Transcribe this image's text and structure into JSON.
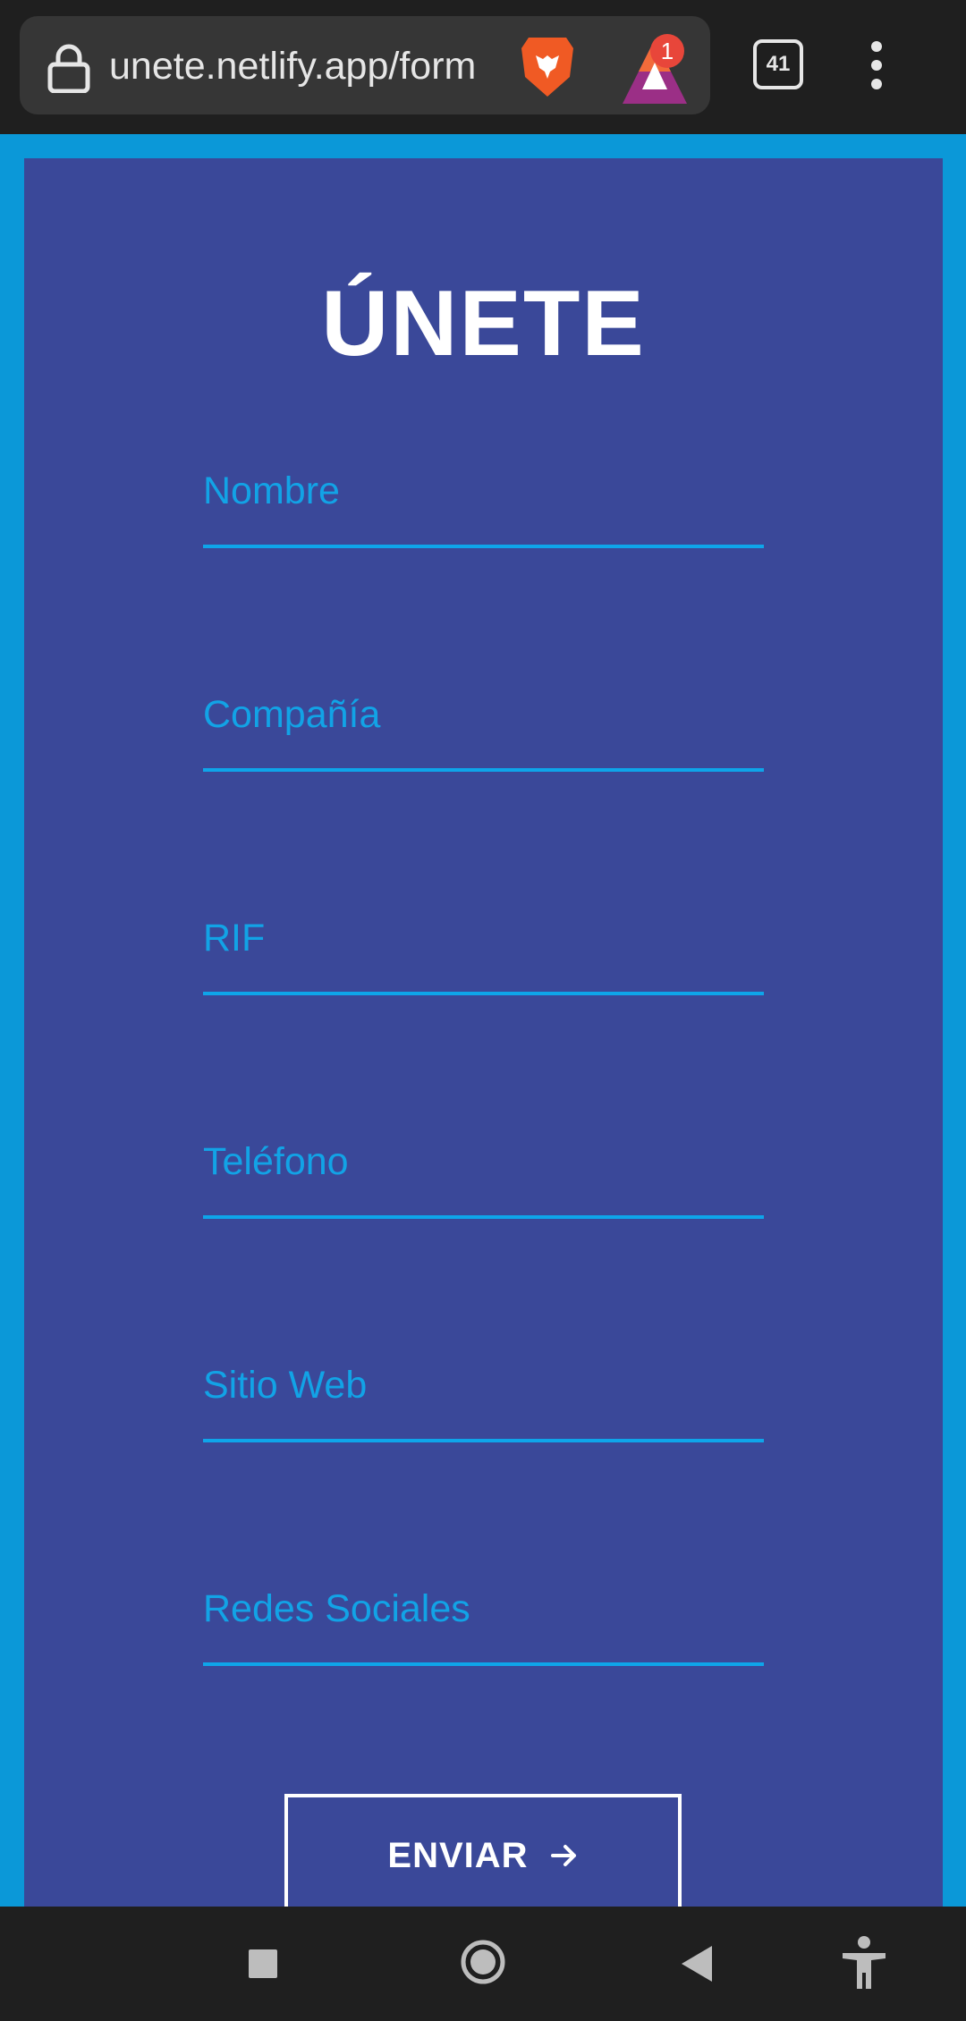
{
  "browser": {
    "url": "unete.netlify.app/form",
    "tab_count": "41",
    "rewards_badge": "1"
  },
  "form": {
    "title": "ÚNETE",
    "fields": [
      {
        "placeholder": "Nombre"
      },
      {
        "placeholder": "Compañía"
      },
      {
        "placeholder": "RIF"
      },
      {
        "placeholder": "Teléfono"
      },
      {
        "placeholder": "Sitio Web"
      },
      {
        "placeholder": "Redes Sociales"
      }
    ],
    "submit_label": "ENVIAR"
  },
  "colors": {
    "page_background": "#0b98d8",
    "card_background": "#3a4899",
    "accent": "#12a3e6",
    "browser_chrome": "#1f1f1f"
  },
  "icons": {
    "address_bar": "lock-icon",
    "shields": "brave-lion-icon",
    "rewards": "bat-rewards-icon",
    "menu": "kebab-menu-icon",
    "submit": "arrow-right-icon",
    "nav": [
      "recents-square-icon",
      "home-circle-icon",
      "back-triangle-icon",
      "accessibility-icon"
    ]
  }
}
